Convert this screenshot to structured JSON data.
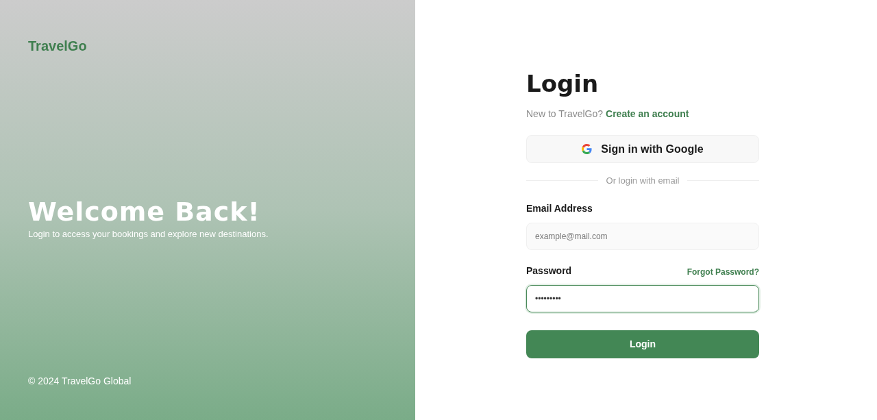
{
  "brand": "TravelGo",
  "hero": {
    "title": "Welcome Back!",
    "subtitle": "Login to access your bookings and explore new destinations."
  },
  "footer": "© 2024 TravelGo Global",
  "form": {
    "title": "Login",
    "prompt": "New to TravelGo?",
    "signup_link": "Create an account",
    "google_button": "Sign in with Google",
    "divider": "Or login with email",
    "fields": [
      {
        "label": "Email Address",
        "placeholder": "example@mail.com",
        "focused": false
      },
      {
        "label": "Password",
        "value": "•••••••••",
        "link": "Forgot Password?",
        "focused": true
      }
    ],
    "submit": "Login"
  }
}
